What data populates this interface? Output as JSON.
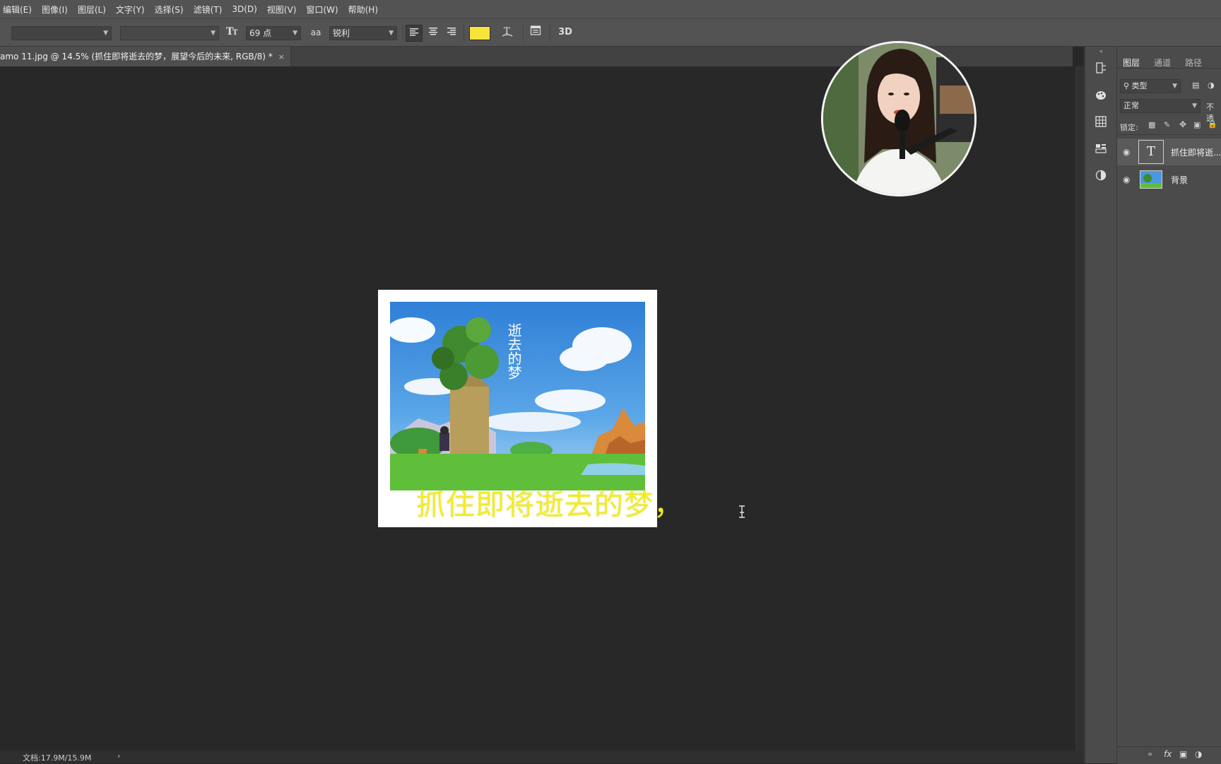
{
  "menu": [
    "编辑(E)",
    "图像(I)",
    "图层(L)",
    "文字(Y)",
    "选择(S)",
    "滤镜(T)",
    "3D(D)",
    "视图(V)",
    "窗口(W)",
    "帮助(H)"
  ],
  "options": {
    "font_family": "",
    "font_style": "",
    "font_size": "69 点",
    "antialias_label": "aa",
    "antialias": "锐利",
    "text_color": "#f8e33a",
    "three_d": "3D"
  },
  "document": {
    "tab_title": "amo 11.jpg @ 14.5% (抓住即将逝去的梦，展望今后的未来, RGB/8) *",
    "close": "×",
    "overlay_text": "抓住即将逝去的梦，",
    "overlay_color": "#f2ec26",
    "watermark_glyphs": "逝去的梦"
  },
  "status": {
    "doc_size": "文档:17.9M/15.9M",
    "arrow": "›"
  },
  "layers_panel": {
    "tabs": [
      "图层",
      "通道",
      "路径"
    ],
    "filter": "类型",
    "blend_mode": "正常",
    "opacity_label": "不透",
    "lock_label": "锁定:",
    "layers": [
      {
        "name": "抓住即将逝...",
        "thumb": "T"
      },
      {
        "name": "背景",
        "thumb": ""
      }
    ]
  }
}
